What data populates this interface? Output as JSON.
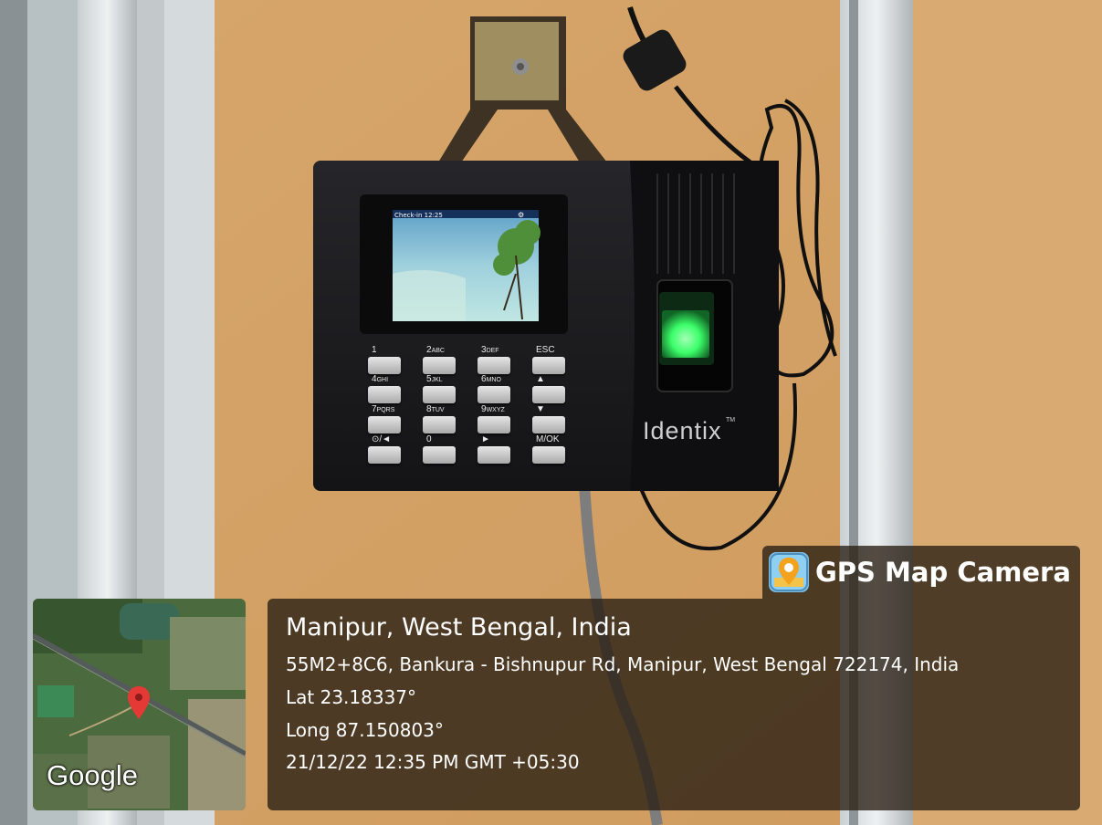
{
  "device": {
    "screen_status": "Check-in  12:25",
    "brand": "Identix",
    "brand_tm": "TM",
    "keys": [
      {
        "num": "1",
        "letters": ""
      },
      {
        "num": "2",
        "letters": "ABC"
      },
      {
        "num": "3",
        "letters": "DEF"
      },
      {
        "num": "ESC",
        "letters": ""
      },
      {
        "num": "4",
        "letters": "GHI"
      },
      {
        "num": "5",
        "letters": "JKL"
      },
      {
        "num": "6",
        "letters": "MNO"
      },
      {
        "num": "▲",
        "letters": ""
      },
      {
        "num": "7",
        "letters": "PQRS"
      },
      {
        "num": "8",
        "letters": "TUV"
      },
      {
        "num": "9",
        "letters": "WXYZ"
      },
      {
        "num": "▼",
        "letters": ""
      },
      {
        "num": "⊙/◄",
        "letters": ""
      },
      {
        "num": "0",
        "letters": ""
      },
      {
        "num": "►",
        "letters": ""
      },
      {
        "num": "M/OK",
        "letters": ""
      }
    ]
  },
  "gps": {
    "app_name": "GPS Map Camera",
    "app_icon": "map-pin-camera-icon",
    "place": "Manipur, West Bengal, India",
    "address": "55M2+8C6, Bankura - Bishnupur Rd, Manipur, West Bengal 722174, India",
    "latitude": "Lat 23.18337°",
    "longitude": "Long 87.150803°",
    "timestamp": "21/12/22 12:35 PM GMT +05:30",
    "map_logo": "Google"
  },
  "colors": {
    "wall": "#d9a86c",
    "device_body": "#1b1b1e",
    "fingerprint_glow": "#3cff6a",
    "overlay_bg": "#281e12",
    "map_pin": "#e53935"
  }
}
